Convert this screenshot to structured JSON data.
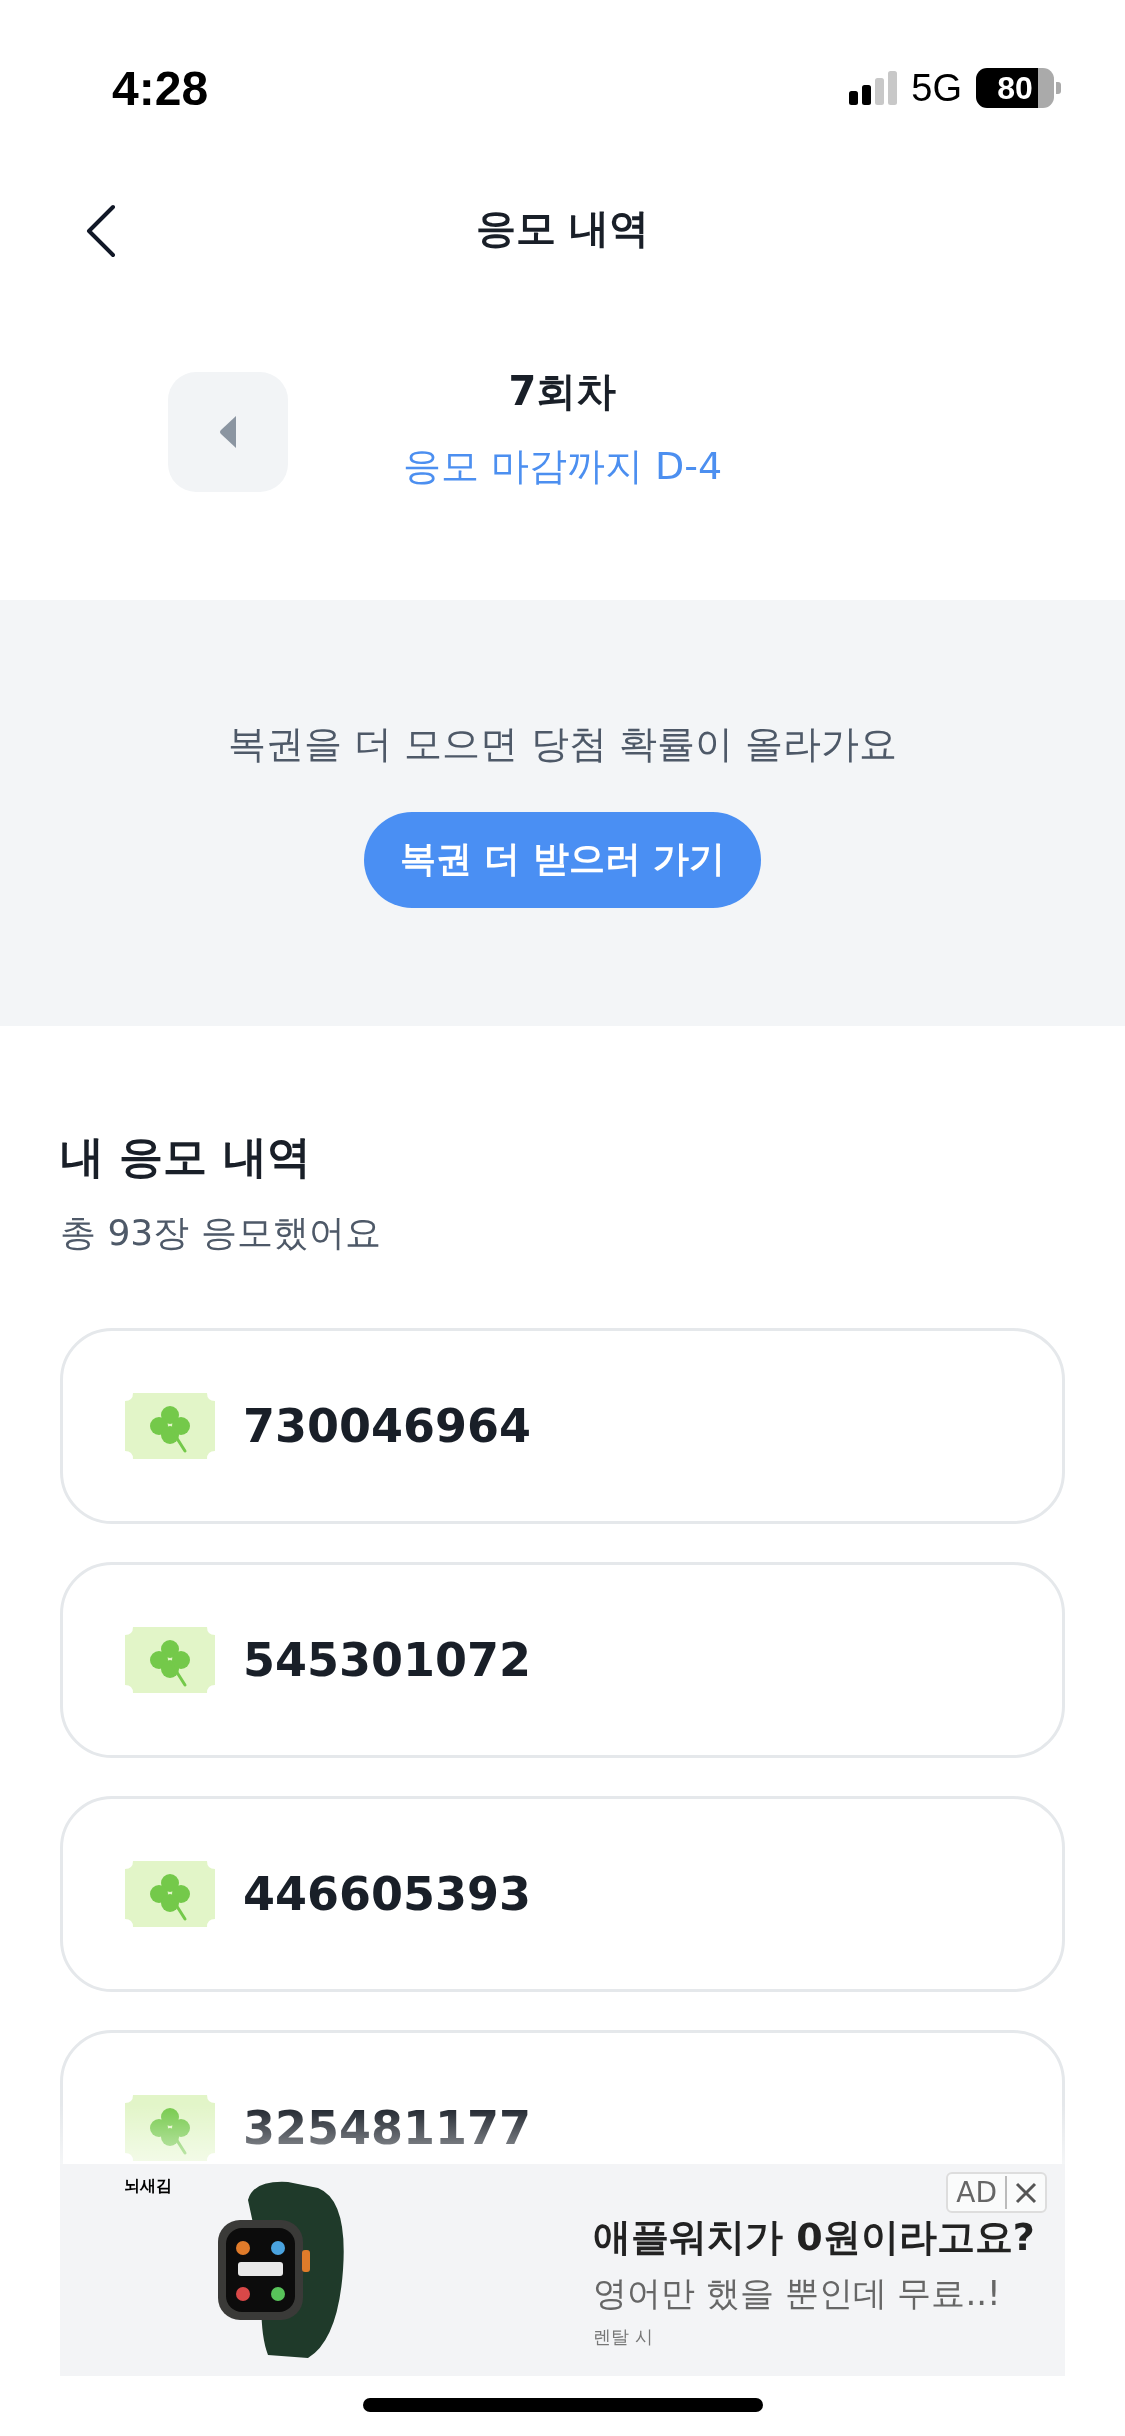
{
  "status_bar": {
    "time": "4:28",
    "network": "5G",
    "battery": "80"
  },
  "nav": {
    "title": "응모 내역"
  },
  "round": {
    "title": "7회차",
    "deadline": "응모 마감까지 D-4"
  },
  "promo": {
    "message": "복권을 더 모으면 당첨 확률이 올라가요",
    "button": "복권 더 받으러 가기"
  },
  "entries": {
    "title": "내 응모 내역",
    "summary": "총 93장 응모했어요",
    "tickets": [
      {
        "number": "730046964"
      },
      {
        "number": "545301072"
      },
      {
        "number": "446605393"
      },
      {
        "number": "325481177"
      }
    ]
  },
  "ad": {
    "brand": "뇌새김",
    "headline": "애플워치가 0원이라고요?",
    "body": "영어만 했을 뿐인데 무료..!",
    "note": "렌탈 시",
    "label": "AD"
  }
}
